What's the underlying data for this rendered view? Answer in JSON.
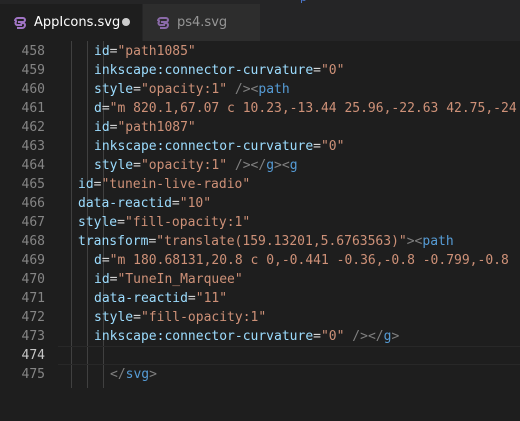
{
  "top_fragment": "p",
  "tabs": [
    {
      "label": "AppIcons.svg",
      "icon": "svg-file-icon",
      "active": true,
      "modified": true
    },
    {
      "label": "ps4.svg",
      "icon": "svg-file-icon",
      "active": false,
      "modified": false
    }
  ],
  "colors": {
    "attribute": "#9cdcfe",
    "string": "#ce9178",
    "tag": "#569cd6",
    "punctuation": "#808080",
    "line_number": "#858585",
    "background": "#1e1e1e",
    "svg_icon": "#a074c4"
  },
  "current_line": 474,
  "lines": [
    {
      "n": "458",
      "indent": 2,
      "tokens": [
        [
          "a",
          "id"
        ],
        [
          "e",
          "="
        ],
        [
          "s",
          "\"path1085\""
        ]
      ]
    },
    {
      "n": "459",
      "indent": 2,
      "tokens": [
        [
          "a",
          "inkscape:connector-curvature"
        ],
        [
          "e",
          "="
        ],
        [
          "s",
          "\"0\""
        ]
      ]
    },
    {
      "n": "460",
      "indent": 2,
      "tokens": [
        [
          "a",
          "style"
        ],
        [
          "e",
          "="
        ],
        [
          "s",
          "\"opacity:1\""
        ],
        [
          "p",
          " />"
        ],
        [
          "p",
          "<"
        ],
        [
          "t",
          "path"
        ]
      ]
    },
    {
      "n": "461",
      "indent": 2,
      "tokens": [
        [
          "a",
          "d"
        ],
        [
          "e",
          "="
        ],
        [
          "s",
          "\"m 820.1,67.07 c 10.23,-13.44 25.96,-22.63 42.75,-24"
        ]
      ]
    },
    {
      "n": "462",
      "indent": 2,
      "tokens": [
        [
          "a",
          "id"
        ],
        [
          "e",
          "="
        ],
        [
          "s",
          "\"path1087\""
        ]
      ]
    },
    {
      "n": "463",
      "indent": 2,
      "tokens": [
        [
          "a",
          "inkscape:connector-curvature"
        ],
        [
          "e",
          "="
        ],
        [
          "s",
          "\"0\""
        ]
      ]
    },
    {
      "n": "464",
      "indent": 2,
      "tokens": [
        [
          "a",
          "style"
        ],
        [
          "e",
          "="
        ],
        [
          "s",
          "\"opacity:1\""
        ],
        [
          "p",
          " /></"
        ],
        [
          "t",
          "g"
        ],
        [
          "p",
          "><"
        ],
        [
          "t",
          "g"
        ]
      ]
    },
    {
      "n": "465",
      "indent": 1,
      "tokens": [
        [
          "a",
          "id"
        ],
        [
          "e",
          "="
        ],
        [
          "s",
          "\"tunein-live-radio\""
        ]
      ]
    },
    {
      "n": "466",
      "indent": 1,
      "tokens": [
        [
          "a",
          "data-reactid"
        ],
        [
          "e",
          "="
        ],
        [
          "s",
          "\"10\""
        ]
      ]
    },
    {
      "n": "467",
      "indent": 1,
      "tokens": [
        [
          "a",
          "style"
        ],
        [
          "e",
          "="
        ],
        [
          "s",
          "\"fill-opacity:1\""
        ]
      ]
    },
    {
      "n": "468",
      "indent": 1,
      "tokens": [
        [
          "a",
          "transform"
        ],
        [
          "e",
          "="
        ],
        [
          "s",
          "\"translate(159.13201,5.6763563)\""
        ],
        [
          "p",
          "><"
        ],
        [
          "t",
          "path"
        ]
      ]
    },
    {
      "n": "469",
      "indent": 2,
      "tokens": [
        [
          "a",
          "d"
        ],
        [
          "e",
          "="
        ],
        [
          "s",
          "\"m 180.68131,20.8 c 0,-0.441 -0.36,-0.8 -0.799,-0.8"
        ]
      ]
    },
    {
      "n": "470",
      "indent": 2,
      "tokens": [
        [
          "a",
          "id"
        ],
        [
          "e",
          "="
        ],
        [
          "s",
          "\"TuneIn_Marquee\""
        ]
      ]
    },
    {
      "n": "471",
      "indent": 2,
      "tokens": [
        [
          "a",
          "data-reactid"
        ],
        [
          "e",
          "="
        ],
        [
          "s",
          "\"11\""
        ]
      ]
    },
    {
      "n": "472",
      "indent": 2,
      "tokens": [
        [
          "a",
          "style"
        ],
        [
          "e",
          "="
        ],
        [
          "s",
          "\"fill-opacity:1\""
        ]
      ]
    },
    {
      "n": "473",
      "indent": 2,
      "tokens": [
        [
          "a",
          "inkscape:connector-curvature"
        ],
        [
          "e",
          "="
        ],
        [
          "s",
          "\"0\""
        ],
        [
          "p",
          " /></"
        ],
        [
          "t",
          "g"
        ],
        [
          "p",
          ">"
        ]
      ]
    },
    {
      "n": "474",
      "indent": 0,
      "tokens": []
    },
    {
      "n": "475",
      "indent": 3,
      "tokens": [
        [
          "p",
          "</"
        ],
        [
          "t",
          "svg"
        ],
        [
          "p",
          ">"
        ]
      ]
    }
  ]
}
